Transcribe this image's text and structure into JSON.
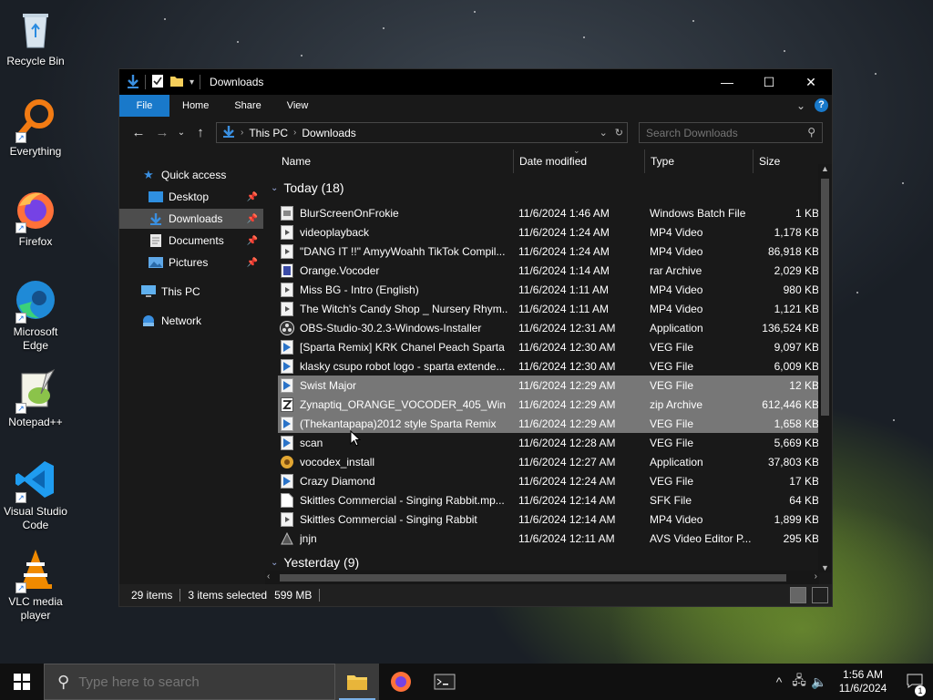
{
  "desktop": {
    "icons": [
      {
        "label": "Recycle Bin",
        "icon": "recycle-bin-icon"
      },
      {
        "label": "Everything",
        "icon": "everything-icon"
      },
      {
        "label": "Firefox",
        "icon": "firefox-icon"
      },
      {
        "label": "Microsoft Edge",
        "icon": "edge-icon"
      },
      {
        "label": "Notepad++",
        "icon": "notepad-plus-plus-icon"
      },
      {
        "label": "Visual Studio Code",
        "icon": "vscode-icon"
      },
      {
        "label": "VLC media player",
        "icon": "vlc-icon"
      }
    ]
  },
  "window": {
    "title": "Downloads",
    "ribbon_tabs": [
      "File",
      "Home",
      "Share",
      "View"
    ],
    "help_label": "?"
  },
  "address": {
    "crumbs": [
      "This PC",
      "Downloads"
    ],
    "search_placeholder": "Search Downloads"
  },
  "nav_pane": {
    "quick_access": "Quick access",
    "items": [
      {
        "label": "Desktop",
        "pinned": true
      },
      {
        "label": "Downloads",
        "pinned": true,
        "selected": true
      },
      {
        "label": "Documents",
        "pinned": true
      },
      {
        "label": "Pictures",
        "pinned": true
      }
    ],
    "this_pc": "This PC",
    "network": "Network"
  },
  "columns": {
    "name": "Name",
    "date": "Date modified",
    "type": "Type",
    "size": "Size"
  },
  "groups": {
    "today": "Today (18)",
    "yesterday": "Yesterday (9)"
  },
  "files": [
    {
      "name": "BlurScreenOnFrokie",
      "date": "11/6/2024 1:46 AM",
      "type": "Windows Batch File",
      "size": "1 KB",
      "icon": "batch-file-icon"
    },
    {
      "name": "videoplayback",
      "date": "11/6/2024 1:24 AM",
      "type": "MP4 Video",
      "size": "1,178 KB",
      "icon": "video-file-icon"
    },
    {
      "name": "\"DANG IT !!\" AmyyWoahh TikTok Compil...",
      "date": "11/6/2024 1:24 AM",
      "type": "MP4 Video",
      "size": "86,918 KB",
      "icon": "video-file-icon"
    },
    {
      "name": "Orange.Vocoder",
      "date": "11/6/2024 1:14 AM",
      "type": "rar Archive",
      "size": "2,029 KB",
      "icon": "rar-archive-icon"
    },
    {
      "name": "Miss BG - Intro (English)",
      "date": "11/6/2024 1:11 AM",
      "type": "MP4 Video",
      "size": "980 KB",
      "icon": "video-file-icon"
    },
    {
      "name": "The Witch's Candy Shop _ Nursery Rhym...",
      "date": "11/6/2024 1:11 AM",
      "type": "MP4 Video",
      "size": "1,121 KB",
      "icon": "video-file-icon"
    },
    {
      "name": "OBS-Studio-30.2.3-Windows-Installer",
      "date": "11/6/2024 12:31 AM",
      "type": "Application",
      "size": "136,524 KB",
      "icon": "obs-app-icon"
    },
    {
      "name": "[Sparta Remix] KRK Chanel Peach Sparta ...",
      "date": "11/6/2024 12:30 AM",
      "type": "VEG File",
      "size": "9,097 KB",
      "icon": "veg-file-icon"
    },
    {
      "name": "klasky csupo robot logo - sparta extende...",
      "date": "11/6/2024 12:30 AM",
      "type": "VEG File",
      "size": "6,009 KB",
      "icon": "veg-file-icon"
    },
    {
      "name": "Swist Major",
      "date": "11/6/2024 12:29 AM",
      "type": "VEG File",
      "size": "12 KB",
      "icon": "veg-file-icon",
      "selected": true
    },
    {
      "name": "Zynaptiq_ORANGE_VOCODER_405_Win",
      "date": "11/6/2024 12:29 AM",
      "type": "zip Archive",
      "size": "612,446 KB",
      "icon": "zip-archive-icon",
      "selected": true
    },
    {
      "name": "(Thekantapapa)2012 style Sparta Remix",
      "date": "11/6/2024 12:29 AM",
      "type": "VEG File",
      "size": "1,658 KB",
      "icon": "veg-file-icon",
      "selected": true
    },
    {
      "name": "scan",
      "date": "11/6/2024 12:28 AM",
      "type": "VEG File",
      "size": "5,669 KB",
      "icon": "veg-file-icon"
    },
    {
      "name": "vocodex_install",
      "date": "11/6/2024 12:27 AM",
      "type": "Application",
      "size": "37,803 KB",
      "icon": "installer-app-icon"
    },
    {
      "name": "Crazy Diamond",
      "date": "11/6/2024 12:24 AM",
      "type": "VEG File",
      "size": "17 KB",
      "icon": "veg-file-icon"
    },
    {
      "name": "Skittles Commercial - Singing Rabbit.mp...",
      "date": "11/6/2024 12:14 AM",
      "type": "SFK File",
      "size": "64 KB",
      "icon": "blank-file-icon"
    },
    {
      "name": "Skittles Commercial - Singing Rabbit",
      "date": "11/6/2024 12:14 AM",
      "type": "MP4 Video",
      "size": "1,899 KB",
      "icon": "video-file-icon"
    },
    {
      "name": "jnjn",
      "date": "11/6/2024 12:11 AM",
      "type": "AVS Video Editor P...",
      "size": "295 KB",
      "icon": "avs-project-icon"
    }
  ],
  "status": {
    "items": "29 items",
    "selected": "3 items selected",
    "size": "599 MB"
  },
  "taskbar": {
    "search_placeholder": "Type here to search",
    "time": "1:56 AM",
    "date": "11/6/2024",
    "notification_count": "1"
  },
  "colors": {
    "accent": "#1979ca",
    "selection": "#777777",
    "window_bg": "#191919"
  }
}
